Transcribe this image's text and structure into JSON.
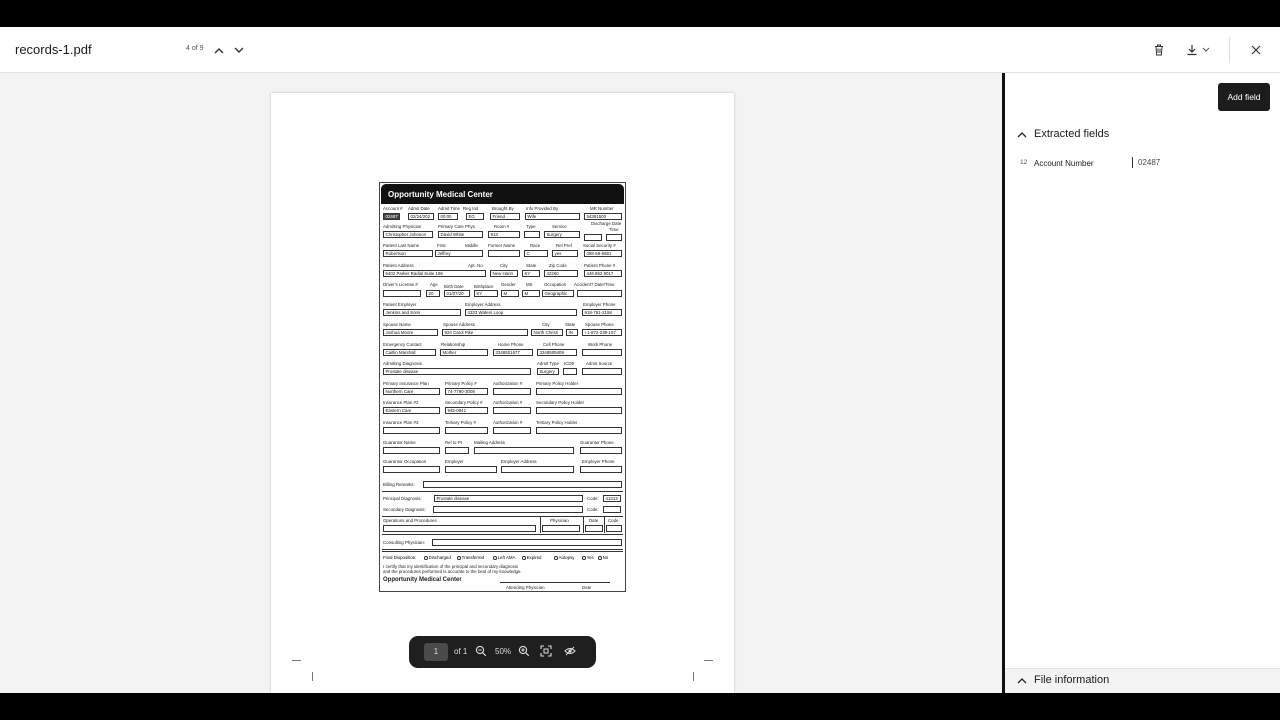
{
  "header": {
    "file_title": "records-1.pdf",
    "page_indicator": "4 of 9"
  },
  "form": {
    "title": "Opportunity Medical Center",
    "r1": {
      "account": "Account #",
      "admit_date": "Admit Date",
      "admit_time": "Admit Time",
      "reg_init": "Reg Init",
      "brought_by": "Brought By",
      "info_by": "Info Provided By",
      "mr_number": "MR Number",
      "v_account": "02487",
      "v_admit_date": "02/24/202",
      "v_admit_time": "00:00",
      "v_reg_init": "EG",
      "v_brought_by": "Friend",
      "v_info_by": "Wife",
      "v_mr": "54391500"
    },
    "r2": {
      "admitting_physician": "Admitting Physician",
      "primary_care": "Primary Care Phys.",
      "room": "Room #",
      "type": "Type",
      "service": "Service",
      "discharge_date": "Discharge Date",
      "time": "Time",
      "v_admitting": "Christopher Johnson",
      "v_primary": "David White",
      "v_room": "913",
      "v_service": "Surgery"
    },
    "r3": {
      "last_name": "Patient Last Name",
      "first": "First",
      "middle": "Middle",
      "former": "Former Name",
      "race": "Race",
      "rel_pref": "Rel Pref",
      "ssn": "Social Security #",
      "v_last": "Robertson",
      "v_first": "Jeffrey",
      "v_race": "C",
      "v_rel": "yes",
      "v_ssn": "088-58-6681"
    },
    "r4": {
      "address": "Patient Address",
      "apt": "Apt. No.",
      "city": "City",
      "state": "State",
      "zip": "Zip Code",
      "phone": "Patient Phone #",
      "v_address": "5402 Parker Radial Suite 186",
      "v_city": "New Hann",
      "v_state": "KY",
      "v_zip": "42260",
      "v_phone": "446.852.9017"
    },
    "r5": {
      "license": "Driver's License #",
      "age": "Age",
      "birth": "Birth Date",
      "birthplace": "Birthplace",
      "gender": "Gender",
      "ms": "MS",
      "occupation": "Occupation",
      "accident": "Accident? Date/Time",
      "v_age": "20",
      "v_birth": "01/07/20",
      "v_birthplace": "KY",
      "v_gender": "M",
      "v_ms": "M",
      "v_occupation": "Geographic"
    },
    "r6": {
      "employer": "Patient Employer",
      "employer_address": "Employer Address",
      "employer_phone": "Employer Phone",
      "v_employer": "Jenkins and Sons",
      "v_employer_address": "4333 Waters Loop",
      "v_employer_phone": "918-761-2158"
    },
    "r7": {
      "spouse": "Spouse Name",
      "spouse_address": "Spouse Address",
      "city": "City",
      "state": "State",
      "spouse_phone": "Spouse Phone",
      "v_spouse": "Joshua Moore",
      "v_spouse_address": "924 Carol Pike",
      "v_city": "North Christi",
      "v_state": "IN",
      "v_spouse_phone": "+1-872-239-157"
    },
    "r8": {
      "emergency": "Emergency Contact",
      "relationship": "Relationship",
      "home_phone": "Home Phone",
      "cell_phone": "Cell Phone",
      "work_phone": "Work Phone",
      "v_emergency": "Caitlin Marshall",
      "v_relationship": "Mother",
      "v_home": "3348501677",
      "v_cell": "3348509409"
    },
    "r9": {
      "admitting_diagnosis": "Admitting Diagnosis",
      "admit_type": "Admit Type",
      "icd9": "ICD9",
      "admit_source": "Admit Source",
      "v_diagnosis": "Prostate disease",
      "v_admit_type": "Surgery"
    },
    "r10": {
      "primary_plan": "Primary Insurance Plan",
      "primary_policy": "Primary Policy #",
      "authorization": "Authorization #",
      "primary_holder": "Primary Policy Holder",
      "v_plan": "Northern Care",
      "v_policy": "74-7790-3008"
    },
    "r11": {
      "plan2": "Insurance Plan #2",
      "secondary_policy": "Secondary Policy #",
      "authorization": "Authorization #",
      "secondary_holder": "Secondary Policy Holder",
      "v_plan2": "Eastern Care",
      "v_policy2": "945-0941"
    },
    "r12": {
      "plan3": "Insurance Plan #3",
      "tertiary_policy": "Tertiary Policy #",
      "authorization": "Authorization #",
      "tertiary_holder": "Tertiary Policy Holder"
    },
    "r13": {
      "guarantor": "Guarantor Name",
      "rel_to_pt": "Rel to Pt",
      "mailing": "Mailing Address",
      "guarantor_phone": "Guarantor Phone"
    },
    "r14": {
      "occupation": "Guarantor Occupation",
      "employer": "Employer",
      "employer_address": "Employer Address",
      "employer_phone": "Employer Phone"
    },
    "billing_remarks": "Billing Remarks:",
    "principal_diagnosis": "Principal Diagnosis:",
    "v_principal": "Prostate disease",
    "code": "Code:",
    "v_code": "41313",
    "secondary_diagnosis": "Secondary Diagnosis:",
    "operations": "Operations and Procedures",
    "physician": "Physician",
    "date": "Date",
    "code2": "Code",
    "consulting": "Consulting Physician:",
    "final_disposition": "Final Disposition:",
    "dispositions": [
      "Discharged",
      "Transferred",
      "Left AMA",
      "Expired"
    ],
    "autopsy": "Autopsy",
    "yes": "Yes",
    "no": "No",
    "certify1": "I certify that my identification of the principal and secondary diagnosis",
    "certify2": "and the procedures performed is accurate to the best of my knowledge.",
    "footer_title": "Opportunity Medical Center",
    "attending": "Attending Physician",
    "footer_date": "Date"
  },
  "zoom_bar": {
    "page_input": "1",
    "of_total": "of 1",
    "zoom_level": "50%"
  },
  "panel": {
    "add_field_label": "Add field",
    "extracted_title": "Extracted fields",
    "fields": [
      {
        "index": "12",
        "name": "Account Number",
        "value": "02487"
      }
    ],
    "file_info_title": "File information"
  },
  "colors": {
    "accent_dark": "#1c1c1c",
    "viewer_bg": "#f3f3f3"
  }
}
